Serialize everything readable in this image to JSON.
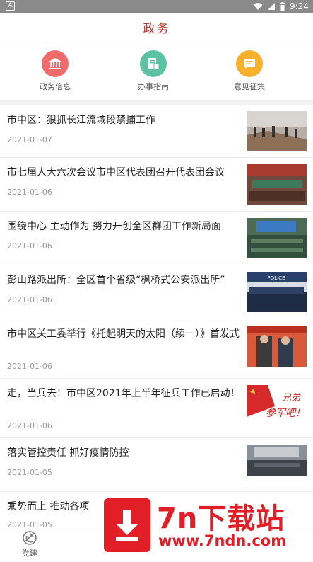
{
  "status_bar": {
    "badge": "A",
    "time": "9:24"
  },
  "header": {
    "title": "政务"
  },
  "quick_nav": [
    {
      "label": "政务信息",
      "icon": "bank-icon",
      "color": "#f06b6b"
    },
    {
      "label": "办事指南",
      "icon": "guide-icon",
      "color": "#5bc3a1"
    },
    {
      "label": "意见征集",
      "icon": "message-icon",
      "color": "#f7b12f"
    }
  ],
  "news": [
    {
      "title": "市中区：狠抓长江流域段禁捕工作",
      "date": "2021-01-07"
    },
    {
      "title": "市七届人大六次会议市中区代表团召开代表团会议",
      "date": "2021-01-06"
    },
    {
      "title": "围绕中心 主动作为 努力开创全区群团工作新局面",
      "date": "2021-01-06"
    },
    {
      "title": "彭山路派出所：全区首个省级“枫桥式公安派出所”",
      "date": "2021-01-06"
    },
    {
      "title": "市中区关工委举行《托起明天的太阳（续一）》首发式",
      "date": "2021-01-06"
    },
    {
      "title": "走，当兵去！市中区2021年上半年征兵工作已启动！",
      "date": "2021-01-06"
    },
    {
      "title": "落实管控责任 抓好疫情防控",
      "date": "2021-01-05"
    },
    {
      "title": "乘势而上 推动各项",
      "date": "2021-01-05"
    }
  ],
  "thumb_texts": {
    "police_banner": "POLICE",
    "recruit_line1": "兄弟",
    "recruit_line2": "参军吧！"
  },
  "bottom_nav": {
    "label": "党建",
    "icon": "party-emblem-icon"
  },
  "watermark": {
    "title": "7n下载站",
    "url": "www.7ndn.com",
    "color": "#e21f26"
  }
}
